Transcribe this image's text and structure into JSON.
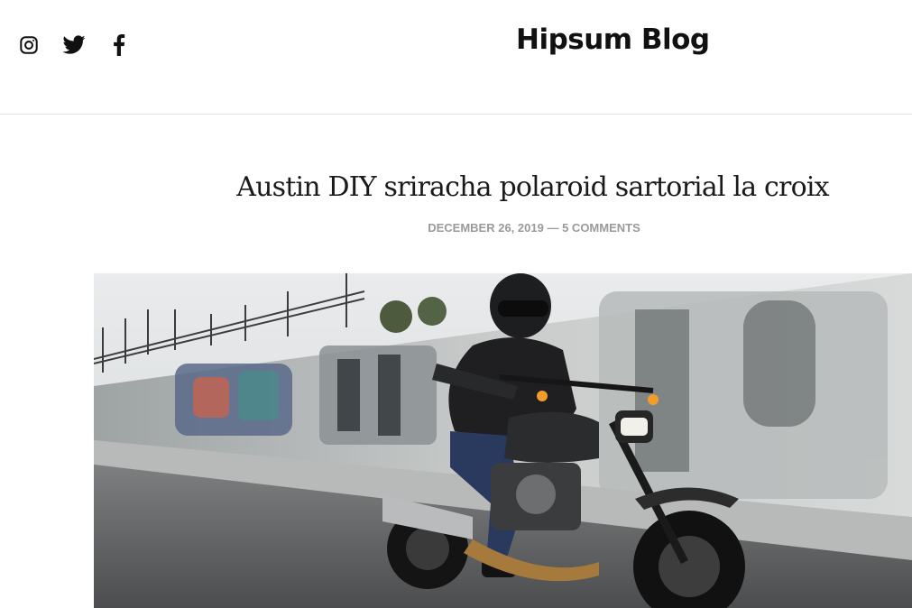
{
  "header": {
    "site_title": "Hipsum Blog",
    "social_icons": [
      "instagram-icon",
      "twitter-icon",
      "facebook-icon"
    ]
  },
  "post": {
    "title": "Austin DIY sriracha polaroid sartorial la croix",
    "date": "DECEMBER 26, 2019",
    "separator": "—",
    "comments": "5 COMMENTS"
  },
  "colors": {
    "text": "#111111",
    "meta": "#9a9a9a",
    "divider": "#e3e3e3"
  }
}
